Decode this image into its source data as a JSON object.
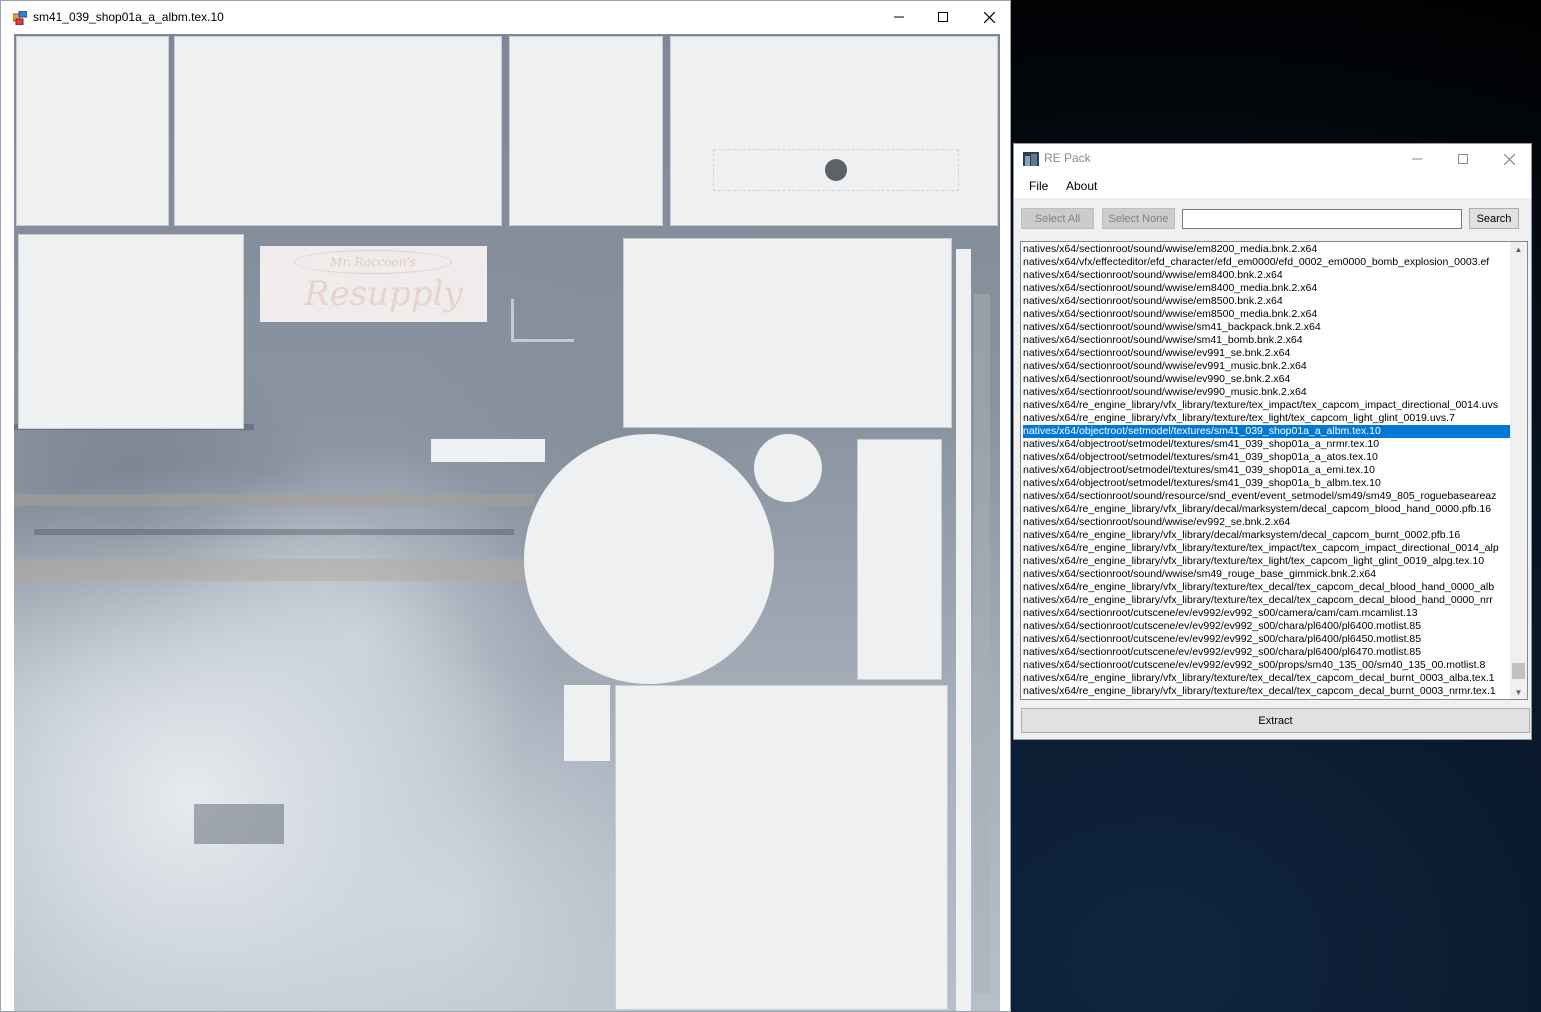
{
  "viewer": {
    "title": "sm41_039_shop01a_a_albm.tex.10",
    "decal_line1": "Mr. Raccoon's",
    "decal_line2": "Resupply"
  },
  "repack": {
    "title": "RE Pack",
    "menu": [
      "File",
      "About"
    ],
    "select_all": "Select All",
    "select_none": "Select None",
    "search_value": "",
    "search_button": "Search",
    "extract_button": "Extract",
    "selected_index": 14,
    "files": [
      "natives/x64/sectionroot/sound/wwise/em8200_media.bnk.2.x64",
      "natives/x64/vfx/effecteditor/efd_character/efd_em0000/efd_0002_em0000_bomb_explosion_0003.ef",
      "natives/x64/sectionroot/sound/wwise/em8400.bnk.2.x64",
      "natives/x64/sectionroot/sound/wwise/em8400_media.bnk.2.x64",
      "natives/x64/sectionroot/sound/wwise/em8500.bnk.2.x64",
      "natives/x64/sectionroot/sound/wwise/em8500_media.bnk.2.x64",
      "natives/x64/sectionroot/sound/wwise/sm41_backpack.bnk.2.x64",
      "natives/x64/sectionroot/sound/wwise/sm41_bomb.bnk.2.x64",
      "natives/x64/sectionroot/sound/wwise/ev991_se.bnk.2.x64",
      "natives/x64/sectionroot/sound/wwise/ev991_music.bnk.2.x64",
      "natives/x64/sectionroot/sound/wwise/ev990_se.bnk.2.x64",
      "natives/x64/sectionroot/sound/wwise/ev990_music.bnk.2.x64",
      "natives/x64/re_engine_library/vfx_library/texture/tex_impact/tex_capcom_impact_directional_0014.uvs",
      "natives/x64/re_engine_library/vfx_library/texture/tex_light/tex_capcom_light_glint_0019.uvs.7",
      "natives/x64/objectroot/setmodel/textures/sm41_039_shop01a_a_albm.tex.10",
      "natives/x64/objectroot/setmodel/textures/sm41_039_shop01a_a_nrmr.tex.10",
      "natives/x64/objectroot/setmodel/textures/sm41_039_shop01a_a_atos.tex.10",
      "natives/x64/objectroot/setmodel/textures/sm41_039_shop01a_a_emi.tex.10",
      "natives/x64/objectroot/setmodel/textures/sm41_039_shop01a_b_albm.tex.10",
      "natives/x64/sectionroot/sound/resource/snd_event/event_setmodel/sm49/sm49_805_roguebaseareaz",
      "natives/x64/re_engine_library/vfx_library/decal/marksystem/decal_capcom_blood_hand_0000.pfb.16",
      "natives/x64/sectionroot/sound/wwise/ev992_se.bnk.2.x64",
      "natives/x64/re_engine_library/vfx_library/decal/marksystem/decal_capcom_burnt_0002.pfb.16",
      "natives/x64/re_engine_library/vfx_library/texture/tex_impact/tex_capcom_impact_directional_0014_alp",
      "natives/x64/re_engine_library/vfx_library/texture/tex_light/tex_capcom_light_glint_0019_alpg.tex.10",
      "natives/x64/sectionroot/sound/wwise/sm49_rouge_base_gimmick.bnk.2.x64",
      "natives/x64/re_engine_library/vfx_library/texture/tex_decal/tex_capcom_decal_blood_hand_0000_alb",
      "natives/x64/re_engine_library/vfx_library/texture/tex_decal/tex_capcom_decal_blood_hand_0000_nrr",
      "natives/x64/sectionroot/cutscene/ev/ev992/ev992_s00/camera/cam/cam.mcamlist.13",
      "natives/x64/sectionroot/cutscene/ev/ev992/ev992_s00/chara/pl6400/pl6400.motlist.85",
      "natives/x64/sectionroot/cutscene/ev/ev992/ev992_s00/chara/pl6400/pl6450.motlist.85",
      "natives/x64/sectionroot/cutscene/ev/ev992/ev992_s00/chara/pl6400/pl6470.motlist.85",
      "natives/x64/sectionroot/cutscene/ev/ev992/ev992_s00/props/sm40_135_00/sm40_135_00.motlist.8",
      "natives/x64/re_engine_library/vfx_library/texture/tex_decal/tex_capcom_decal_burnt_0003_alba.tex.1",
      "natives/x64/re_engine_library/vfx_library/texture/tex_decal/tex_capcom_decal_burnt_0003_nrmr.tex.1"
    ]
  }
}
